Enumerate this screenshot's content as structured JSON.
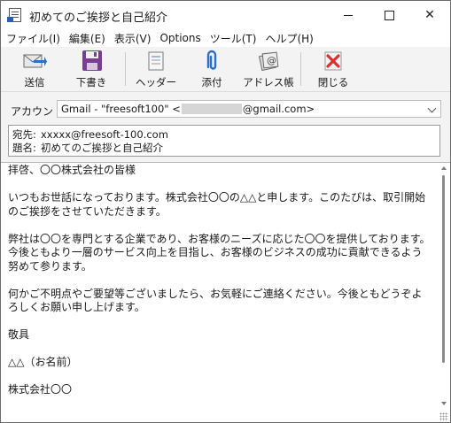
{
  "window": {
    "title": "初めてのご挨拶と自己紹介",
    "close_glyph": "✕"
  },
  "menu": [
    "ファイル(I)",
    "編集(E)",
    "表示(V)",
    "Options",
    "ツール(T)",
    "ヘルプ(H)"
  ],
  "toolbar": {
    "send": "送信",
    "draft": "下書き",
    "header": "ヘッダー",
    "attach": "添付",
    "address_book": "アドレス帳",
    "close": "閉じる"
  },
  "account": {
    "label": "アカウント:",
    "value_prefix": "Gmail - \"freesoft100\" <",
    "value_suffix": "@gmail.com>"
  },
  "headers": {
    "to_label": "宛先:",
    "to_value": "xxxxx@freesoft-100.com",
    "subject_label": "題名:",
    "subject_value": "初めてのご挨拶と自己紹介"
  },
  "body": {
    "l1": "拝啓、〇〇株式会社の皆様",
    "l2": "いつもお世話になっております。株式会社〇〇の△△と申します。このたびは、取引開始のご挨拶をさせていただきます。",
    "l3": "弊社は〇〇を専門とする企業であり、お客様のニーズに応じた〇〇を提供しております。今後ともより一層のサービス向上を目指し、お客様のビジネスの成功に貢献できるよう努めて参ります。",
    "l4": "何かご不明点やご要望等ございましたら、お気軽にご連絡ください。今後ともどうぞよろしくお願い申し上げます。",
    "l5": "敬具",
    "l6": "△△（お名前）",
    "l7": "株式会社〇〇"
  },
  "colors": {
    "spell_underline": "#e03030",
    "send_blue": "#2a6fc9",
    "close_red": "#d93030",
    "draft_purple": "#7a3e8f"
  },
  "icons": [
    "send-icon",
    "floppy-disk-icon",
    "header-icon",
    "paperclip-icon",
    "address-book-icon",
    "close-x-icon"
  ]
}
